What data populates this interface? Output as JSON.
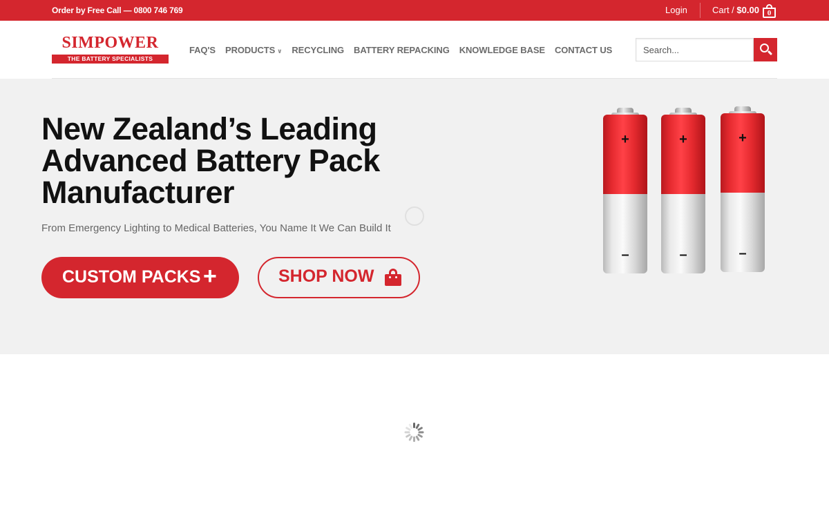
{
  "topbar": {
    "promo": "Order by Free Call — 0800 746 769",
    "login": "Login",
    "cart_label": "Cart / ",
    "cart_total": "$0.00",
    "cart_count": "0"
  },
  "logo": {
    "name": "SIMPOWER",
    "tagline": "THE BATTERY SPECIALISTS"
  },
  "nav": {
    "items": [
      {
        "label": "FAQ'S"
      },
      {
        "label": "PRODUCTS"
      },
      {
        "label": "RECYCLING"
      },
      {
        "label": "BATTERY REPACKING"
      },
      {
        "label": "KNOWLEDGE BASE"
      },
      {
        "label": "CONTACT US"
      }
    ]
  },
  "search": {
    "placeholder": "Search..."
  },
  "hero": {
    "title": "New Zealand’s Leading Advanced Battery Pack Manufacturer",
    "subtitle": "From Emergency Lighting to Medical Batteries, You Name It We Can Build It",
    "custom_button": "CUSTOM PACKS",
    "custom_icon": "+",
    "shop_button": "SHOP NOW",
    "battery_positive": "+",
    "battery_negative": "–"
  },
  "colors": {
    "brand": "#d4262e",
    "hero_bg": "#f1f1f1"
  }
}
